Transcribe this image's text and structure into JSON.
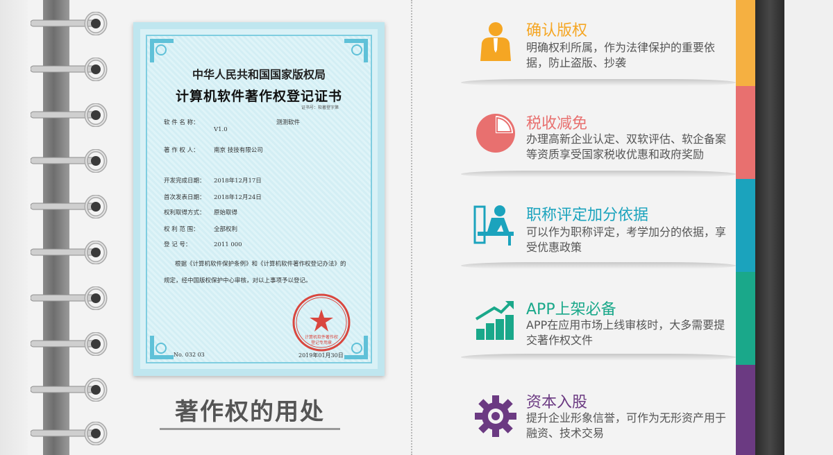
{
  "certificate": {
    "title1": "中华人民共和国国家版权局",
    "title2": "计算机软件著作权登记证书",
    "cert_no_label": "证书号：软著登字第",
    "rows": [
      {
        "label": "软 件 名 称：",
        "value": "测测软件"
      },
      {
        "label": "",
        "value": "V1.0"
      },
      {
        "label": "著 作 权 人：",
        "value": "南京                技技有限公司"
      },
      {
        "label": "开发完成日期：",
        "value": "2018年12月17日"
      },
      {
        "label": "首次发表日期：",
        "value": "2018年12月24日"
      },
      {
        "label": "权利取得方式：",
        "value": "原始取得"
      },
      {
        "label": "权 利 范 围：",
        "value": "全部权利"
      },
      {
        "label": "登   记   号：",
        "value": "2011          000"
      }
    ],
    "para1": "根据《计算机软件保护条例》和《计算机软件著作权登记办法》的",
    "para2": "规定，经中国版权保护中心审核，对以上事项予以登记。",
    "stamp_text": "中华人民共和国国家版权局",
    "stamp_sub1": "计算机软件著作权",
    "stamp_sub2": "登记专用章",
    "number": "No. 032   03",
    "stamp_date": "2019年01月30日"
  },
  "caption": "著作权的用处",
  "items": [
    {
      "title": "确认版权",
      "desc": "明确权利所属，作为法律保护的重要依据，防止盗版、抄袭",
      "color": "#f5a623",
      "icon": "person-icon"
    },
    {
      "title": "税收减免",
      "desc": "办理高新企业认定、双软评估、软企备案等资质享受国家税收优惠和政府奖励",
      "color": "#e8706f",
      "icon": "pie-chart-icon"
    },
    {
      "title": "职称评定加分依据",
      "desc": "可以作为职称评定，考学加分的依据，享受优惠政策",
      "color": "#1ba3bd",
      "icon": "desk-worker-icon"
    },
    {
      "title": "APP上架必备",
      "desc": "APP在应用市场上线审核时，大多需要提交著作权文件",
      "color": "#1aa88a",
      "icon": "growth-chart-icon"
    },
    {
      "title": "资本入股",
      "desc": "提升企业形象信誉，可作为无形资产用于融资、技术交易",
      "color": "#6b3a82",
      "icon": "gear-icon"
    }
  ]
}
